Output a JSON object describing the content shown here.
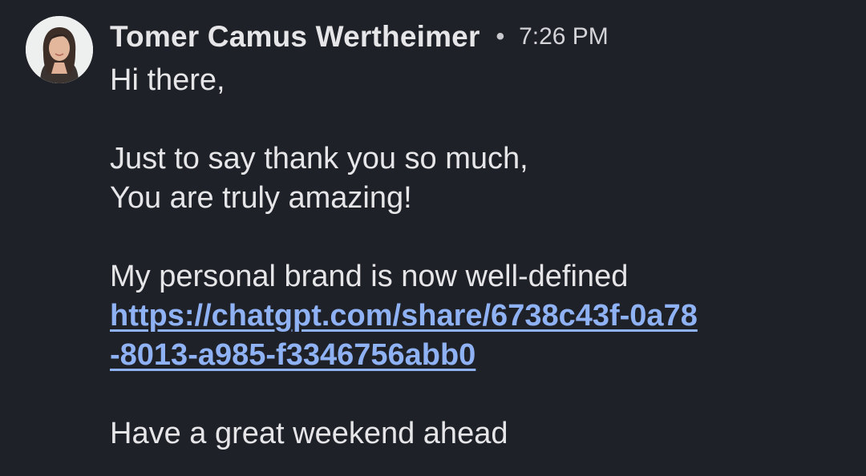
{
  "message": {
    "sender": "Tomer Camus Wertheimer",
    "separator": "•",
    "time": "7:26 PM",
    "avatar_icon": "profile-photo",
    "lines": {
      "greeting": "Hi there,",
      "thanks_1": "Just to say thank you so much,",
      "thanks_2": "You are truly amazing!",
      "brand": "My personal brand is now well-defined",
      "link_part_1": "https://chatgpt.com/share/6738c43f-0a78",
      "link_part_2": "-8013-a985-f3346756abb0",
      "closing": "Have a great weekend ahead"
    }
  },
  "colors": {
    "background": "#1f2129",
    "text": "#e6e6e8",
    "link": "#8fb2f4"
  }
}
